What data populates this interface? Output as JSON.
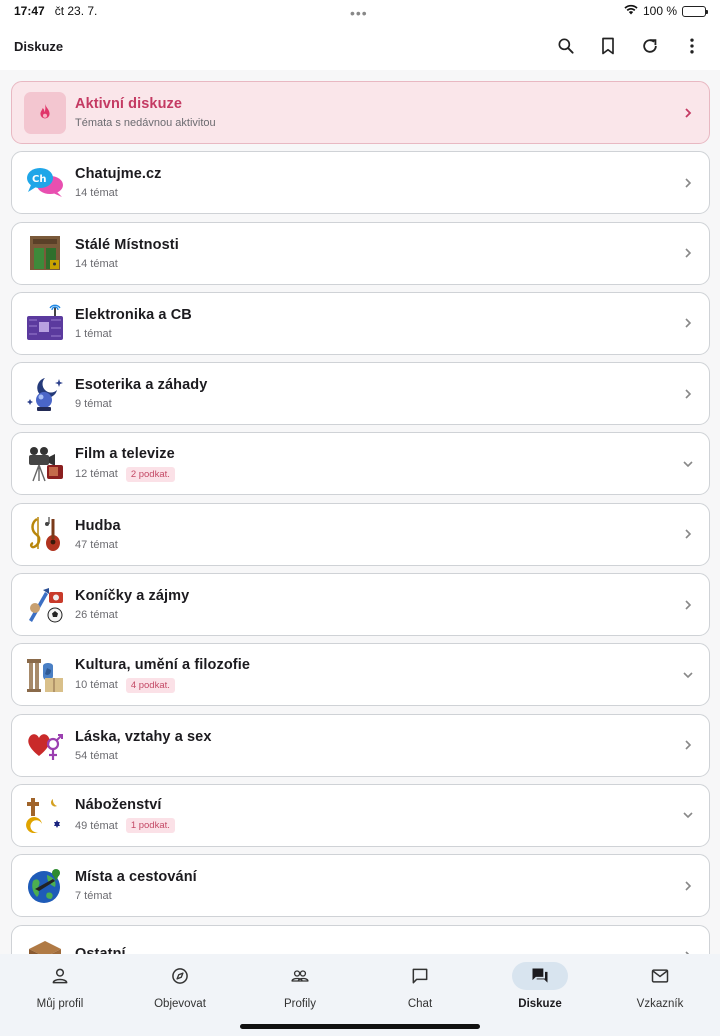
{
  "status_bar": {
    "time": "17:47",
    "date": "čt 23. 7.",
    "battery": "100 %"
  },
  "app_bar": {
    "title": "Diskuze",
    "actions": [
      "search-icon",
      "bookmark-icon",
      "refresh-icon",
      "more-vert-icon"
    ]
  },
  "colors": {
    "accent": "#c43a63",
    "active_bg": "#fae6ea",
    "badge_bg": "#fbe1e7",
    "nav_active": "#d8e4ef"
  },
  "categories": [
    {
      "name": "Aktivní diskuze",
      "sub": "Témata s nedávnou aktivitou",
      "badge": "",
      "icon": "fire-icon",
      "expand": "chevron-right"
    },
    {
      "name": "Chatujme.cz",
      "sub": "14 témat",
      "badge": "",
      "icon": "chat-bubbles-icon",
      "expand": "chevron-right"
    },
    {
      "name": "Stálé Místnosti",
      "sub": "14 témat",
      "badge": "",
      "icon": "building-door-icon",
      "expand": "chevron-right"
    },
    {
      "name": "Elektronika a CB",
      "sub": "1 témat",
      "badge": "",
      "icon": "circuit-antenna-icon",
      "expand": "chevron-right"
    },
    {
      "name": "Esoterika a záhady",
      "sub": "9 témat",
      "badge": "",
      "icon": "moon-crystal-ball-icon",
      "expand": "chevron-right"
    },
    {
      "name": "Film a televize",
      "sub": "12 témat",
      "badge": "2 podkat.",
      "icon": "camera-tv-icon",
      "expand": "chevron-down"
    },
    {
      "name": "Hudba",
      "sub": "47 témat",
      "badge": "",
      "icon": "music-icon",
      "expand": "chevron-right"
    },
    {
      "name": "Koníčky a zájmy",
      "sub": "26 témat",
      "badge": "",
      "icon": "hobbies-icon",
      "expand": "chevron-right"
    },
    {
      "name": "Kultura, umění a filozofie",
      "sub": "10 témat",
      "badge": "4 podkat.",
      "icon": "culture-icon",
      "expand": "chevron-down"
    },
    {
      "name": "Láska, vztahy a sex",
      "sub": "54 témat",
      "badge": "",
      "icon": "heart-gender-icon",
      "expand": "chevron-right"
    },
    {
      "name": "Náboženství",
      "sub": "49 témat",
      "badge": "1 podkat.",
      "icon": "religion-icon",
      "expand": "chevron-down"
    },
    {
      "name": "Místa a cestování",
      "sub": "7 témat",
      "badge": "",
      "icon": "globe-plane-icon",
      "expand": "chevron-right"
    },
    {
      "name": "Ostatní",
      "sub": "",
      "badge": "",
      "icon": "box-icon",
      "expand": "chevron-right"
    }
  ],
  "bottom_nav": [
    {
      "label": "Můj profil",
      "icon": "person-icon",
      "active": false
    },
    {
      "label": "Objevovat",
      "icon": "compass-icon",
      "active": false
    },
    {
      "label": "Profily",
      "icon": "people-icon",
      "active": false
    },
    {
      "label": "Chat",
      "icon": "chat-icon",
      "active": false
    },
    {
      "label": "Diskuze",
      "icon": "forum-icon",
      "active": true
    },
    {
      "label": "Vzkazník",
      "icon": "mail-icon",
      "active": false
    }
  ]
}
